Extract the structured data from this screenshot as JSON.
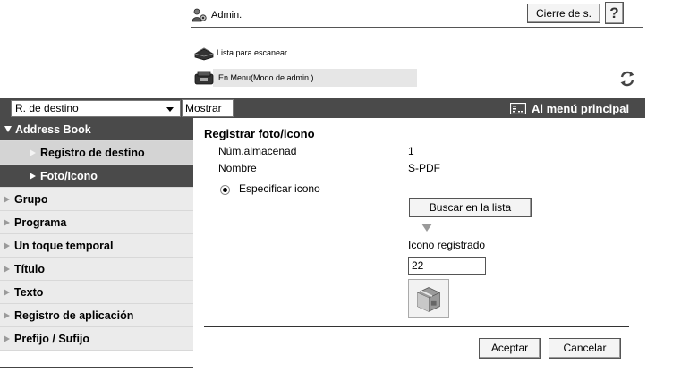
{
  "header": {
    "admin_label": "Admin.",
    "logout_button": "Cierre de s.",
    "help_button": "?",
    "scan_list_link": "Lista para escanear",
    "menu_mode_link": "En Menu(Modo de admin.)"
  },
  "toolbar": {
    "dest_select_value": "R. de destino",
    "show_button": "Mostrar",
    "main_menu_link": "Al menú principal"
  },
  "sidebar": {
    "items": [
      {
        "label": "Address Book",
        "state": "expanded"
      },
      {
        "label": "Registro de destino",
        "state": "sub"
      },
      {
        "label": "Foto/Icono",
        "state": "sub-active"
      },
      {
        "label": "Grupo",
        "state": "normal"
      },
      {
        "label": "Programa",
        "state": "normal"
      },
      {
        "label": "Un toque temporal",
        "state": "normal"
      },
      {
        "label": "Título",
        "state": "normal"
      },
      {
        "label": "Texto",
        "state": "normal"
      },
      {
        "label": "Registro de aplicación",
        "state": "normal"
      },
      {
        "label": "Prefijo / Sufijo",
        "state": "normal"
      }
    ]
  },
  "main": {
    "title": "Registrar foto/icono",
    "storage_label": "Núm.almacenad",
    "storage_value": "1",
    "name_label": "Nombre",
    "name_value": "S-PDF",
    "radio_label": "Especificar icono",
    "search_list_button": "Buscar en la lista",
    "registered_icon_label": "Icono registrado",
    "registered_icon_value": "22",
    "accept_button": "Aceptar",
    "cancel_button": "Cancelar"
  },
  "colors": {
    "dark_bar": "#4a4a4a",
    "sidebar_item": "#ebebeb",
    "sidebar_sub": "#d4d4d4",
    "button_face": "#f4f4f4"
  }
}
